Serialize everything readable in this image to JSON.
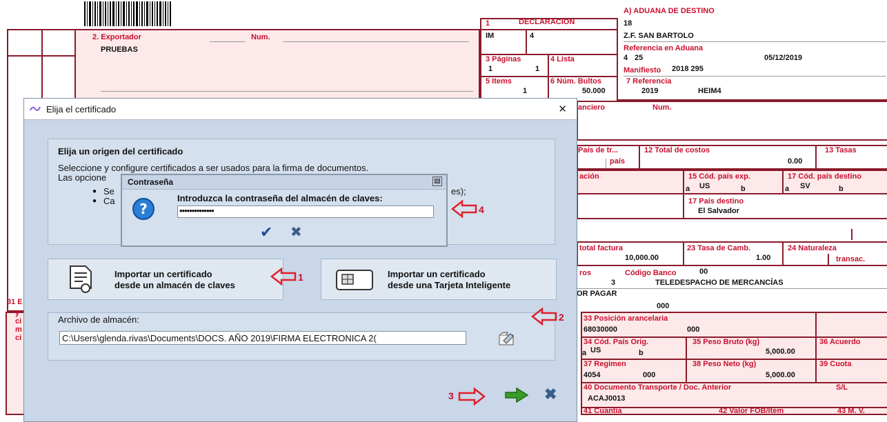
{
  "form": {
    "header_a_label": "A) ADUANA DE DESTINO",
    "aduana_code": "18",
    "aduana_name": "Z.F. SAN BARTOLO",
    "ref_aduana_label": "Referencia en Aduana",
    "ref_aduana_value1": "4",
    "ref_aduana_value2": "25",
    "ref_aduana_date": "05/12/2019",
    "manifiesto_label": "Manifiesto",
    "manifiesto_value": "2018 295",
    "box1_label": "1",
    "declaracion_label": "DECLARACION",
    "decl_value1": "IM",
    "decl_value2": "4",
    "paginas_label": "3 Páginas",
    "paginas_v1": "1",
    "paginas_v2": "1",
    "lista_label": "4 Lista",
    "items_label": "5 Items",
    "items_value": "1",
    "bultos_label": "6 Núm. Bultos",
    "bultos_value": "50.000",
    "referencia_label": "7 Referencia",
    "referencia_year": "2019",
    "referencia_code": "HEIM4",
    "exportador_label": "2. Exportador",
    "num_label": "Num.",
    "exportador_value": "PRUEBAS",
    "financiero_label": "anciero",
    "num2_label": "Num.",
    "pais_tr_label": "País de tr...",
    "pais_label": "país",
    "total_costos_label": "12 Total de costos",
    "total_costos_value": "0.00",
    "tasas_label": "13 Tasas",
    "cod_pais_exp_label": "15 Cód. país exp.",
    "cod_pais_exp_a": "a",
    "cod_pais_exp_value": "US",
    "cod_pais_exp_b": "b",
    "cod_pais_dest_label": "17 Cód. país destino",
    "cod_pais_dest_a": "a",
    "cod_pais_dest_value": "SV",
    "cod_pais_dest_b": "b",
    "ubicacion_label": "ación",
    "pais_destino_label": "17 País destino",
    "pais_destino_value": "El Salvador",
    "total_factura_label": "total factura",
    "total_factura_value": "10,000.00",
    "tasa_cambio_label": "23 Tasa de Camb.",
    "tasa_cambio_value": "1.00",
    "naturaleza_label": "24 Naturaleza",
    "transac_label": "transac.",
    "ros_label": "ros",
    "codigo_banco_label": "Código Banco",
    "codigo_banco_value": "00",
    "teledespacho_num": "3",
    "teledespacho_label": "TELEDESPACHO DE MERCANCÍAS",
    "por_pagar_label": "OR PAGAR",
    "por_pagar_value": "000",
    "box31_label": "31 E",
    "box31_l2": "y",
    "box31_l3": "ci",
    "box31_l4": "m",
    "box31_l5": "ci",
    "pos_arancel_label": "33 Posición arancelaria",
    "pos_arancel_value": "68030000",
    "pos_arancel_sub": "000",
    "cod_pais_orig_label": "34 Cód. País Orig.",
    "cod_pais_orig_a": "a",
    "cod_pais_orig_value": "US",
    "cod_pais_orig_b": "b",
    "peso_bruto_label": "35 Peso Bruto (kg)",
    "peso_bruto_value": "5,000.00",
    "acuerdo_label": "36 Acuerdo",
    "regimen_label": "37 Regimen",
    "regimen_value": "4054",
    "regimen_sub": "000",
    "peso_neto_label": "38 Peso Neto (kg)",
    "peso_neto_value": "5,000.00",
    "cuota_label": "39 Cuota",
    "doc_transporte_label": "40 Documento Transporte / Doc. Anterior",
    "sl_label": "S/L",
    "doc_transporte_value": "ACAJ0013",
    "cuantia_label": "41 Cuantía",
    "valor_fob_label": "42 Valor FOB/Item",
    "mv_label": "43 M. V."
  },
  "dialog": {
    "title": "Elija el certificado",
    "close_glyph": "✕",
    "origin_title": "Elija un origen del certificado",
    "origin_desc1": "Seleccione y configure certificados a ser usados para la firma de documentos.",
    "origin_desc2": "Las opcione",
    "bullet1": "Se",
    "bullet1_tail": "es);",
    "bullet2": "Ca",
    "import_store_line1": "Importar un certificado",
    "import_store_line2": "desde un almacén de claves",
    "import_card_line1": "Importar un certificado",
    "import_card_line2": "desde una Tarjeta Inteligente",
    "archivo_label": "Archivo de almacén:",
    "archivo_value": "C:\\Users\\glenda.rivas\\Documents\\DOCS. AÑO 2019\\FIRMA ELECTRONICA 2("
  },
  "password": {
    "title": "Contraseña",
    "prompt": "Introduzca la contraseña del almacén de claves:",
    "value": "••••••••••••••",
    "ok_glyph": "✔",
    "cancel_glyph": "✖"
  },
  "annotations": {
    "n1": "1",
    "n2": "2",
    "n3": "3",
    "n4": "4"
  },
  "colors": {
    "form_red": "#c8102e",
    "border_dark": "#8b1a2b",
    "dialog_bg": "#c9d7e8",
    "accent_green": "#3a9a2a"
  }
}
